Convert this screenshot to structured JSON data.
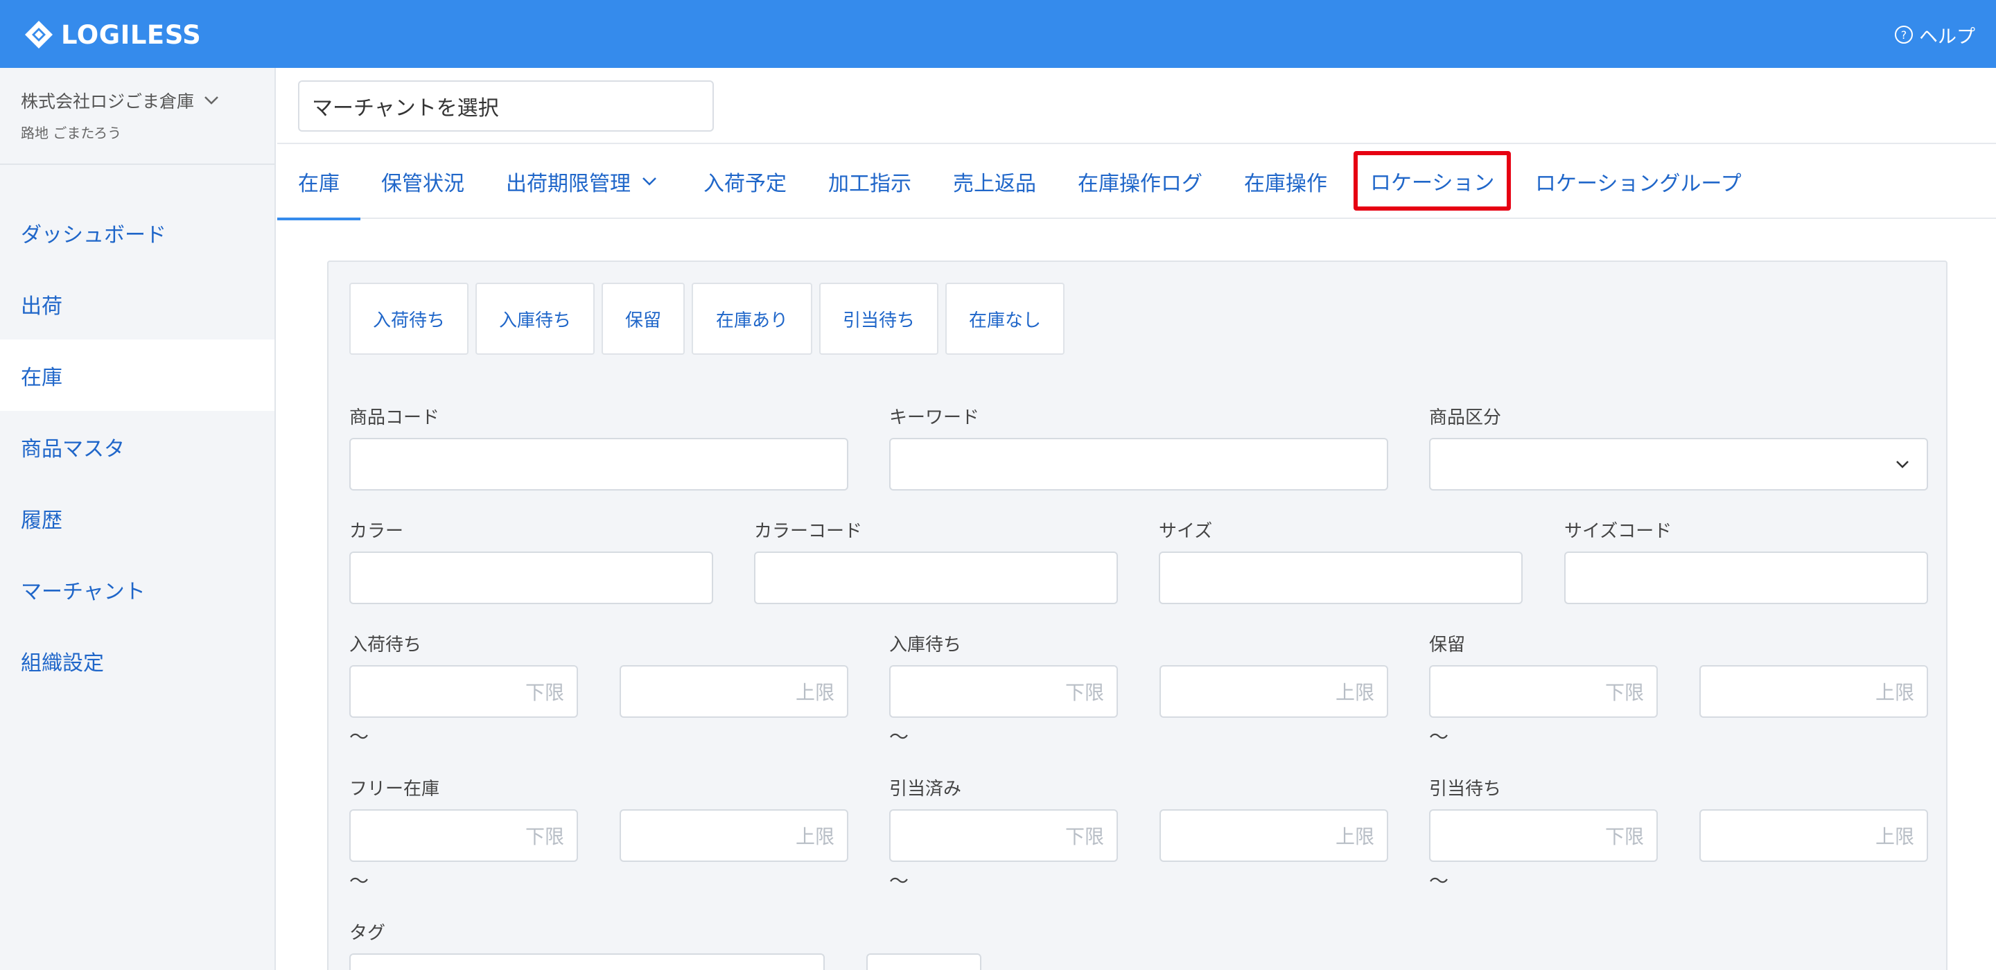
{
  "header": {
    "logo_text": "LOGILESS",
    "help_label": "ヘルプ"
  },
  "sidebar": {
    "org_name": "株式会社ロジごま倉庫",
    "org_user": "路地 ごまたろう",
    "items": [
      {
        "label": "ダッシュボード"
      },
      {
        "label": "出荷"
      },
      {
        "label": "在庫"
      },
      {
        "label": "商品マスタ"
      },
      {
        "label": "履歴"
      },
      {
        "label": "マーチャント"
      },
      {
        "label": "組織設定"
      }
    ]
  },
  "merchant_select": {
    "label": "マーチャントを選択"
  },
  "tabs": [
    {
      "label": "在庫"
    },
    {
      "label": "保管状況"
    },
    {
      "label": "出荷期限管理"
    },
    {
      "label": "入荷予定"
    },
    {
      "label": "加工指示"
    },
    {
      "label": "売上返品"
    },
    {
      "label": "在庫操作ログ"
    },
    {
      "label": "在庫操作"
    },
    {
      "label": "ロケーション"
    },
    {
      "label": "ロケーショングループ"
    }
  ],
  "filters": [
    {
      "label": "入荷待ち"
    },
    {
      "label": "入庫待ち"
    },
    {
      "label": "保留"
    },
    {
      "label": "在庫あり"
    },
    {
      "label": "引当待ち"
    },
    {
      "label": "在庫なし"
    }
  ],
  "fields": {
    "product_code": "商品コード",
    "keyword": "キーワード",
    "product_category": "商品区分",
    "color": "カラー",
    "color_code": "カラーコード",
    "size": "サイズ",
    "size_code": "サイズコード",
    "arrival_waiting": "入荷待ち",
    "stock_in_waiting": "入庫待ち",
    "hold": "保留",
    "free_stock": "フリー在庫",
    "allocated": "引当済み",
    "allocation_waiting": "引当待ち",
    "tag": "タグ"
  },
  "range": {
    "min_placeholder": "下限",
    "max_placeholder": "上限",
    "separator": "〜"
  },
  "colors": {
    "header_bg": "#358bec",
    "link": "#1f66c9",
    "highlight": "#e60012"
  }
}
